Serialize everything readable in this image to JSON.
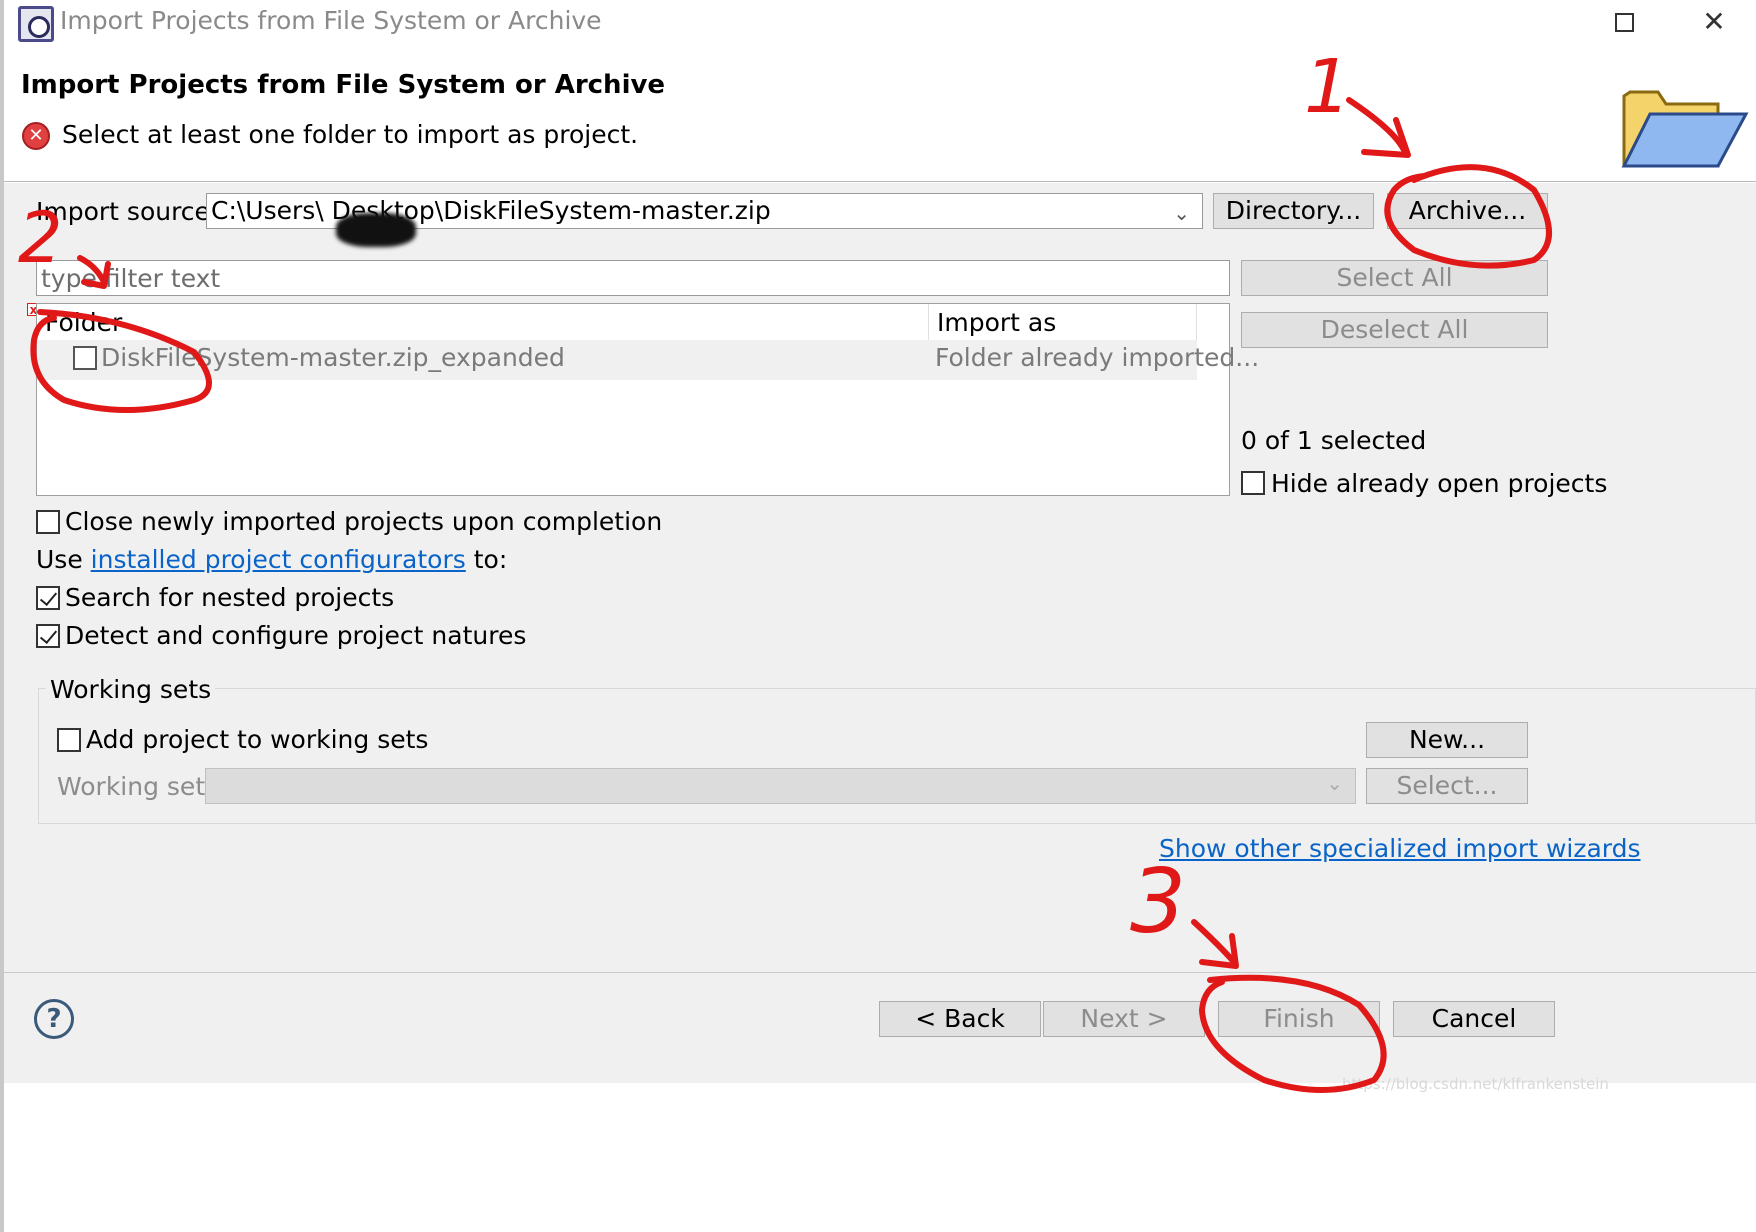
{
  "window": {
    "title": "Import Projects from File System or Archive"
  },
  "header": {
    "title": "Import Projects from File System or Archive",
    "message": "Select at least one folder to import as project."
  },
  "import_source": {
    "label": "Import source:",
    "value": "C:\\Users\\      Desktop\\DiskFileSystem-master.zip",
    "directory_button": "Directory...",
    "archive_button": "Archive..."
  },
  "filter": {
    "placeholder": "type filter text"
  },
  "table": {
    "columns": [
      "Folder",
      "Import as"
    ],
    "rows": [
      {
        "folder": "DiskFileSystem-master.zip_expanded",
        "import_as": "Folder already imported..."
      }
    ]
  },
  "side": {
    "select_all": "Select All",
    "deselect_all": "Deselect All",
    "selected_count": "0 of 1 selected",
    "hide_open": "Hide already open projects"
  },
  "options": {
    "close_newly": "Close newly imported projects upon completion",
    "use_prefix": "Use",
    "configurators_link": "installed project configurators",
    "use_suffix": "to:",
    "search_nested": "Search for nested projects",
    "detect_natures": "Detect and configure project natures"
  },
  "working_sets": {
    "title": "Working sets",
    "add_label": "Add project to working sets",
    "new_button": "New...",
    "sets_label": "Working sets:",
    "select_button": "Select..."
  },
  "specialized_link": "Show other specialized import wizards",
  "footer": {
    "back": "< Back",
    "next": "Next >",
    "finish": "Finish",
    "cancel": "Cancel"
  },
  "annotations": {
    "one": "1",
    "two": "2",
    "three": "3"
  },
  "watermark": "https://blog.csdn.net/klfrankenstein",
  "colors": {
    "annotation_red": "#e01818",
    "link_blue": "#0a64c8",
    "error_red": "#e04040"
  }
}
